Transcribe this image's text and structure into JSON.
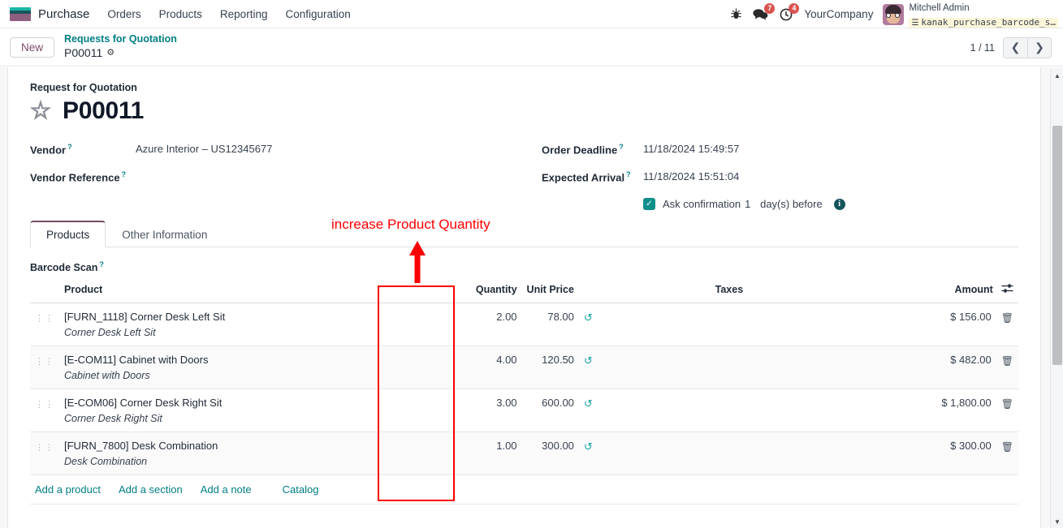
{
  "navbar": {
    "logo_icon": "odoo-logo-icon",
    "app_name": "Purchase",
    "menu": [
      {
        "label": "Orders"
      },
      {
        "label": "Products"
      },
      {
        "label": "Reporting"
      },
      {
        "label": "Configuration"
      }
    ],
    "icons": {
      "bug": "bug-icon",
      "messages": "chat-bubble-icon",
      "activities": "clock-icon"
    },
    "messages_count": "7",
    "activities_count": "4",
    "company": "YourCompany",
    "user_name": "Mitchell Admin",
    "database": "kanak_purchase_barcode_s…",
    "database_icon": "database-list-icon"
  },
  "controlpanel": {
    "new_button": "New",
    "breadcrumb_parent": "Requests for Quotation",
    "breadcrumb_current": "P00011",
    "gear_icon": "gear-icon",
    "pager": "1 / 11",
    "prev_icon": "chevron-left-icon",
    "next_icon": "chevron-right-icon"
  },
  "form": {
    "form_label": "Request for Quotation",
    "star_icon": "star-icon",
    "record_name": "P00011",
    "left_fields": [
      {
        "label": "Vendor",
        "help": "?",
        "value": "Azure Interior – US12345677"
      },
      {
        "label": "Vendor Reference",
        "help": "?",
        "value": ""
      }
    ],
    "right_fields": [
      {
        "label": "Order Deadline",
        "help": "?",
        "value": "11/18/2024 15:49:57"
      },
      {
        "label": "Expected Arrival",
        "help": "?",
        "value": "11/18/2024 15:51:04"
      }
    ],
    "confirmation": {
      "checked": true,
      "label_before": "Ask confirmation",
      "days": "1",
      "label_after": "day(s) before",
      "info_icon": "info-icon"
    }
  },
  "tabs": [
    {
      "label": "Products",
      "active": true
    },
    {
      "label": "Other Information",
      "active": false
    }
  ],
  "barcode": {
    "label": "Barcode Scan",
    "help": "?"
  },
  "lines_table": {
    "columns": {
      "product": "Product",
      "quantity": "Quantity",
      "unit_price": "Unit Price",
      "taxes": "Taxes",
      "amount": "Amount"
    },
    "options_icon": "column-options-icon",
    "handle_icon": "drag-handle-icon",
    "history_icon": "history-reset-icon",
    "delete_icon": "trash-icon",
    "rows": [
      {
        "product": "[FURN_1118] Corner Desk Left Sit",
        "description": "Corner Desk Left Sit",
        "quantity": "2.00",
        "unit_price": "78.00",
        "taxes": "",
        "amount": "$ 156.00"
      },
      {
        "product": "[E-COM11] Cabinet with Doors",
        "description": "Cabinet with Doors",
        "quantity": "4.00",
        "unit_price": "120.50",
        "taxes": "",
        "amount": "$ 482.00"
      },
      {
        "product": "[E-COM06] Corner Desk Right Sit",
        "description": "Corner Desk Right Sit",
        "quantity": "3.00",
        "unit_price": "600.00",
        "taxes": "",
        "amount": "$ 1,800.00"
      },
      {
        "product": "[FURN_7800] Desk Combination",
        "description": "Desk Combination",
        "quantity": "1.00",
        "unit_price": "300.00",
        "taxes": "",
        "amount": "$ 300.00"
      }
    ],
    "add_links": [
      {
        "label": "Add a product"
      },
      {
        "label": "Add a section"
      },
      {
        "label": "Add a note"
      },
      {
        "label": "Catalog"
      }
    ]
  },
  "annotation": {
    "text": "increase Product Quantity",
    "color": "#ff0000",
    "arrow_icon": "up-arrow-annotation-icon",
    "highlight_icon": "red-rectangle-highlight"
  },
  "scrollbar": {
    "up_icon": "scroll-up-icon",
    "down_icon": "scroll-down-icon"
  }
}
